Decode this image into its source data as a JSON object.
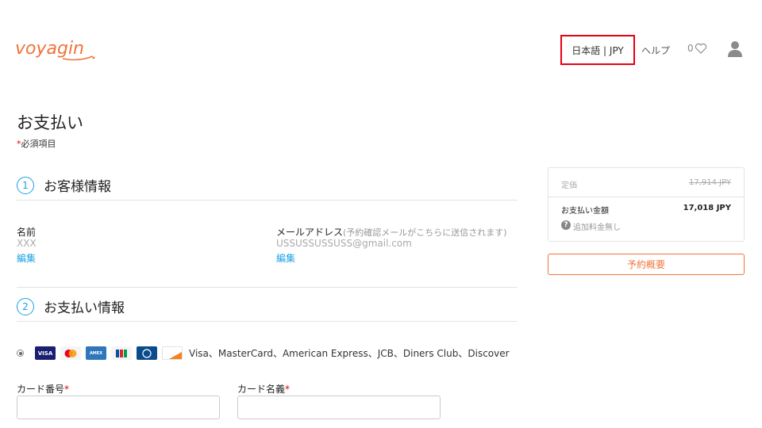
{
  "brand": {
    "logo_text": "voyagin",
    "color": "#f0743b"
  },
  "header": {
    "language_currency": "日本語 | JPY",
    "help": "ヘルプ",
    "favorites_count": "0",
    "icons": {
      "favorites": "heart-outline-icon",
      "user": "user-silhouette-icon"
    }
  },
  "page": {
    "title": "お支払い",
    "required_mark": "*",
    "required_note": "必須項目"
  },
  "customer_section": {
    "number": "1",
    "title": "お客様情報",
    "name_label": "名前",
    "name_value": "XXX",
    "name_edit": "編集",
    "email_label": "メールアドレス",
    "email_note": "(予約確認メールがこちらに送信されます)",
    "email_value": "USSUSSUSSUSS@gmail.com",
    "email_edit": "編集"
  },
  "payment_section": {
    "number": "2",
    "title": "お支払い情報",
    "accepted_cards": "Visa、MasterCard、American Express、JCB、Diners Club、Discover",
    "card_icons": [
      "visa-icon",
      "mastercard-icon",
      "amex-icon",
      "jcb-icon",
      "diners-club-icon",
      "discover-icon"
    ],
    "card_number_label": "カード番号",
    "card_name_label": "カード名義",
    "required_mark": "*"
  },
  "summary": {
    "list_price_label": "定価",
    "list_price_value": "17,914 JPY",
    "total_label": "お支払い金額",
    "total_value": "17,018 JPY",
    "extra_fee_note": "追加料金無し",
    "overview_button": "予約概要"
  },
  "colors": {
    "accent_blue": "#1ca0e3",
    "accent_orange": "#f0743b",
    "highlight_red": "#e60012"
  }
}
